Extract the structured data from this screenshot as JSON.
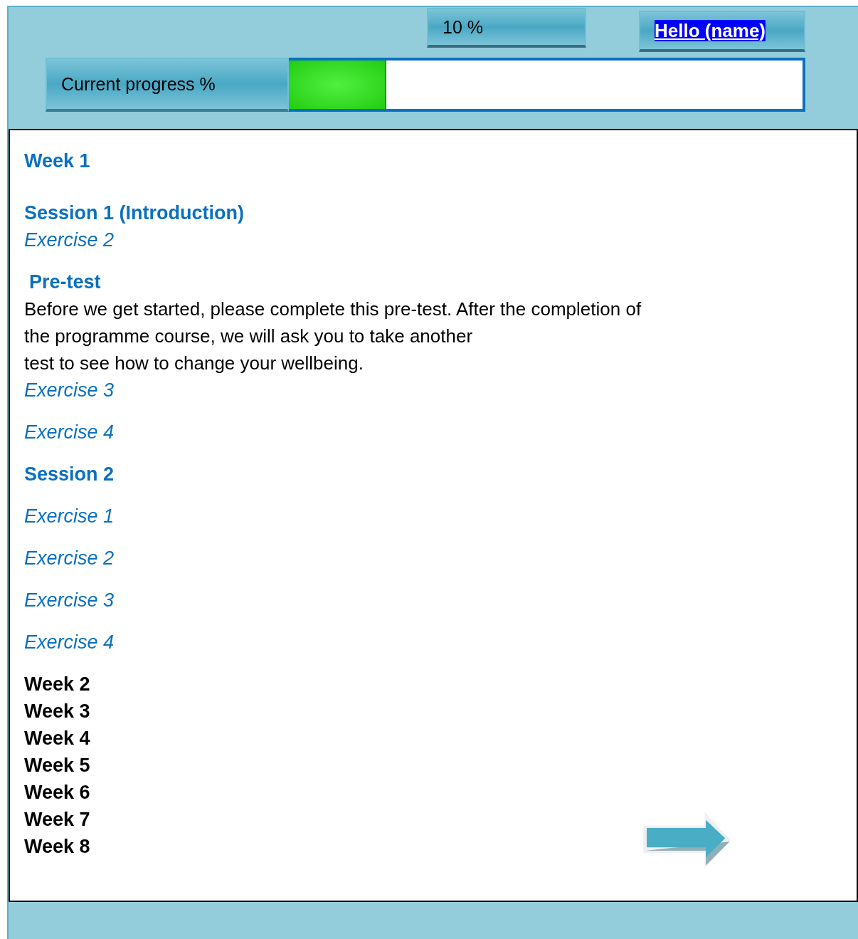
{
  "header": {
    "percent": "10 %",
    "greeting": "Hello (name)",
    "progress_label": "Current progress %",
    "progress": {
      "level": 0.19
    }
  },
  "items": [
    {
      "kind": "week",
      "label": "Week 1",
      "expanded": true
    },
    {
      "kind": "session",
      "label": "Session 1 (Introduction)"
    },
    {
      "kind": "exercise",
      "label": "Exercise 2"
    },
    {
      "kind": "pretest",
      "label": "Pre-test"
    },
    {
      "kind": "paragraph",
      "lines": [
        "Before we get started, please complete this pre-test. After the completion of",
        "the programme course, we will ask you to take another",
        "test to see how to change your wellbeing."
      ]
    },
    {
      "kind": "exercise",
      "label": "Exercise 3"
    },
    {
      "kind": "exercise",
      "label": "Exercise 4"
    },
    {
      "kind": "session",
      "label": "Session 2"
    },
    {
      "kind": "exercise",
      "label": "Exercise 1"
    },
    {
      "kind": "exercise",
      "label": "Exercise 2"
    },
    {
      "kind": "exercise",
      "label": "Exercise 3"
    },
    {
      "kind": "exercise",
      "label": "Exercise 4"
    },
    {
      "kind": "week",
      "label": "Week 2",
      "expanded": false
    },
    {
      "kind": "week",
      "label": "Week 3",
      "expanded": false
    },
    {
      "kind": "week",
      "label": "Week 4",
      "expanded": false
    },
    {
      "kind": "week",
      "label": "Week 5",
      "expanded": false
    },
    {
      "kind": "week",
      "label": "Week 6",
      "expanded": false
    },
    {
      "kind": "week",
      "label": "Week 7",
      "expanded": false
    },
    {
      "kind": "week",
      "label": "Week 8",
      "expanded": false
    }
  ]
}
